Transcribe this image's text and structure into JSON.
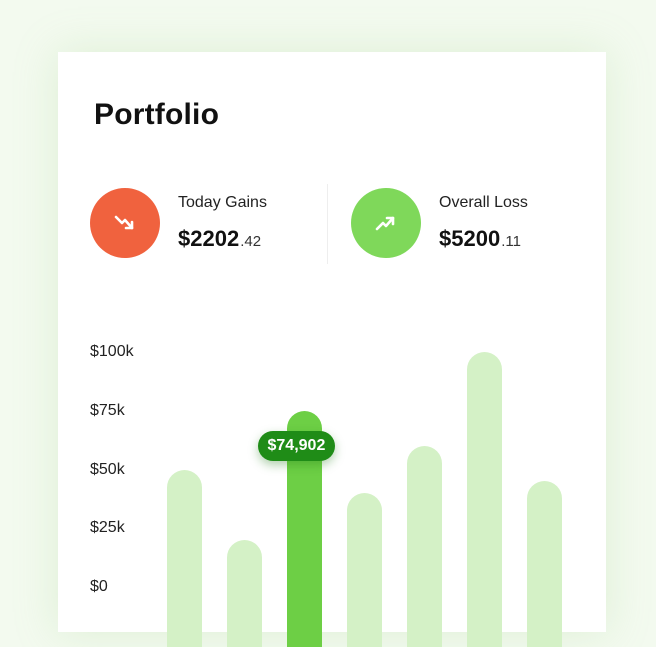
{
  "portfolio": {
    "title": "Portfolio",
    "today": {
      "label": "Today Gains",
      "amount": "$2202",
      "cents": ".42",
      "icon": "trend-down-icon",
      "color": "#f0623e"
    },
    "overall": {
      "label": "Overall Loss",
      "amount": "$5200",
      "cents": ".11",
      "icon": "trend-up-icon",
      "color": "#7fd85a"
    }
  },
  "chart_data": {
    "type": "bar",
    "title": "",
    "xlabel": "",
    "ylabel": "",
    "ylim": [
      0,
      100000
    ],
    "ytick_labels": [
      "$100k",
      "$75k",
      "$50k",
      "$25k",
      "$0"
    ],
    "values": [
      50000,
      20000,
      74902,
      40000,
      60000,
      100000,
      45000
    ],
    "highlight_index": 2,
    "tooltip": "$74,902",
    "colors": {
      "bar": "#d4f1c6",
      "active": "#6dcf45",
      "tooltip": "#1f8c17"
    }
  }
}
